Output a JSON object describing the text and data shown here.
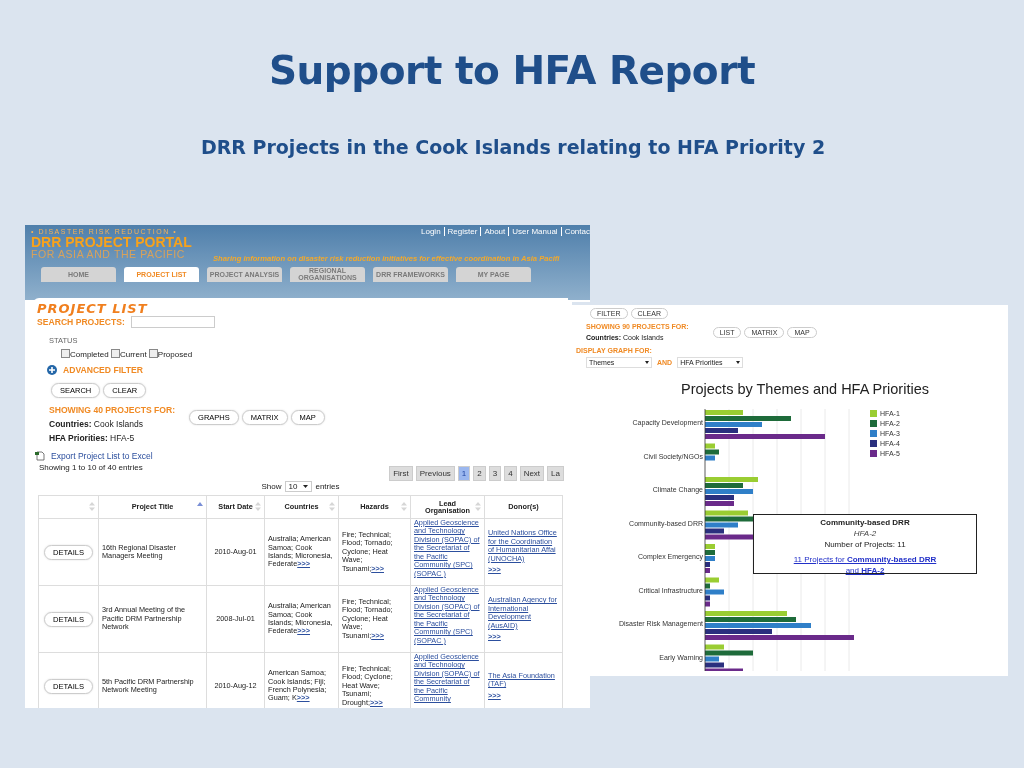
{
  "slide": {
    "title": "Support to HFA Report",
    "subtitle": "DRR Projects in the Cook Islands relating to HFA Priority 2"
  },
  "portal": {
    "logo": {
      "tagline": "• DISASTER RISK REDUCTION •",
      "name": "DRR PROJECT PORTAL",
      "region": "FOR ASIA AND THE PACIFIC"
    },
    "top_links": [
      "Login",
      "Register",
      "About",
      "User Manual",
      "Contac"
    ],
    "slogan": "Sharing information on disaster risk reduction initiatives for effective coordination in Asia Pacifi",
    "tabs": [
      {
        "label": "HOME",
        "selected": false
      },
      {
        "label": "PROJECT LIST",
        "selected": true
      },
      {
        "label": "PROJECT ANALYSIS",
        "selected": false
      },
      {
        "label": "REGIONAL ORGANISATIONS",
        "selected": false
      },
      {
        "label": "DRR FRAMEWORKS",
        "selected": false
      },
      {
        "label": "MY PAGE",
        "selected": false
      }
    ],
    "heading": "PROJECT LIST",
    "search_label": "SEARCH PROJECTS:",
    "status": {
      "label": "STATUS",
      "options": [
        {
          "label": "Completed",
          "checked": false
        },
        {
          "label": "Current",
          "checked": false
        },
        {
          "label": "Proposed",
          "checked": false
        }
      ]
    },
    "advanced_filter": "ADVANCED FILTER",
    "buttons": [
      "SEARCH",
      "CLEAR"
    ],
    "showing": "SHOWING 40 PROJECTS FOR:",
    "filters": [
      {
        "key": "Countries:",
        "value": "Cook Islands"
      },
      {
        "key": "HFA Priorities:",
        "value": "HFA-5"
      }
    ],
    "view_buttons": [
      "GRAPHS",
      "MATRIX",
      "MAP"
    ],
    "export": "Export Project List to Excel",
    "info": "Showing 1 to 10 of 40 entries",
    "pagination": [
      {
        "label": "First",
        "selected": false
      },
      {
        "label": "Previous",
        "selected": false
      },
      {
        "label": "1",
        "selected": true
      },
      {
        "label": "2",
        "selected": false
      },
      {
        "label": "3",
        "selected": false
      },
      {
        "label": "4",
        "selected": false
      },
      {
        "label": "Next",
        "selected": false
      },
      {
        "label": "La",
        "selected": false
      }
    ],
    "length": {
      "before": "Show",
      "value": "10",
      "after": "entries"
    },
    "table": {
      "columns": [
        {
          "sorted": false
        },
        {
          "label": "Project Title",
          "sorted": true
        },
        {
          "label": "Start Date",
          "sorted": false
        },
        {
          "label": "Countries",
          "sorted": false
        },
        {
          "label": "Hazards",
          "sorted": false
        },
        {
          "label": "Lead Organisation",
          "sorted": false
        },
        {
          "label": "Donor(s)"
        }
      ],
      "rows": [
        {
          "button": "DETAILS",
          "title": "16th Regional Disaster Managers Meeting",
          "start_date": "2010-Aug-01",
          "countries": "Australia; American Samoa; Cook Islands; Micronesia, Federate",
          "countries_more": ">>>",
          "hazards": "Fire; Technical; Flood; Tornado; Cyclone; Heat Wave; Tsunami;",
          "hazards_more": ">>>",
          "lead": "Applied Geoscience and Technology Division (SOPAC) of the Secretariat of the Pacific Community (SPC) (SOPAC )",
          "donor": "United Nations Office for the Coordination of Humanitarian Affai (UNOCHA)",
          "donor_more": ">>>"
        },
        {
          "button": "DETAILS",
          "title": "3rd Annual Meeting of the Pacific DRM Partnership Network",
          "start_date": "2008-Jul-01",
          "countries": "Australia; American Samoa; Cook Islands; Micronesia, Federate",
          "countries_more": ">>>",
          "hazards": "Fire; Technical; Flood; Tornado; Cyclone; Heat Wave; Tsunami;",
          "hazards_more": ">>>",
          "lead": "Applied Geoscience and Technology Division (SOPAC) of the Secretariat of the Pacific Community (SPC) (SOPAC )",
          "donor": "Australian Agency for International Development (AusAID)",
          "donor_more": ">>>"
        },
        {
          "button": "DETAILS",
          "title": "5th Pacific DRM Partnership Network Meeting",
          "start_date": "2010-Aug-12",
          "countries": "American Samoa; Cook Islands; Fiji; French Polynesia; Guam; K",
          "countries_more": ">>>",
          "hazards": "Fire; Technical; Flood; Cyclone; Heat Wave; Tsunami; Drought;",
          "hazards_more": ">>>",
          "lead": "Applied Geoscience and Technology Division (SOPAC) of the Secretariat of the Pacific Community",
          "donor": "The Asia Foundation (TAF)",
          "donor_more": ">>>"
        }
      ]
    }
  },
  "graph_page": {
    "buttons": [
      "FILTER",
      "CLEAR"
    ],
    "showing": "SHOWING 90 PROJECTS FOR:",
    "filter": {
      "key": "Countries:",
      "value": "Cook Islands"
    },
    "view_buttons": [
      "LIST",
      "MATRIX",
      "MAP"
    ],
    "display_label": "DISPLAY GRAPH FOR:",
    "selects": [
      {
        "value": "Themes"
      },
      {
        "value": "HFA Priorities"
      }
    ],
    "joiner": "AND",
    "chart": {
      "title": "Projects by Themes and HFA Priorities",
      "categories": [
        "Capacity Development",
        "Civil Society/NGOs",
        "Climate Change",
        "Community-based DRR",
        "Complex Emergency",
        "Critical Infrastructure",
        "Disaster Risk Management",
        "Early Warning"
      ],
      "legend": [
        {
          "label": "HFA-1",
          "color": "#9acd32"
        },
        {
          "label": "HFA-2",
          "color": "#1e6b3a"
        },
        {
          "label": "HFA-3",
          "color": "#2f7fc8"
        },
        {
          "label": "HFA-4",
          "color": "#2a2f7e"
        },
        {
          "label": "HFA-5",
          "color": "#6a2a8a"
        }
      ],
      "tooltip": {
        "title": "Community-based DRR",
        "series": "HFA-2",
        "count": "Number of Projects: 11",
        "link": "11 Projects for **Community-based DRR** and **HFA-2**"
      }
    }
  }
}
